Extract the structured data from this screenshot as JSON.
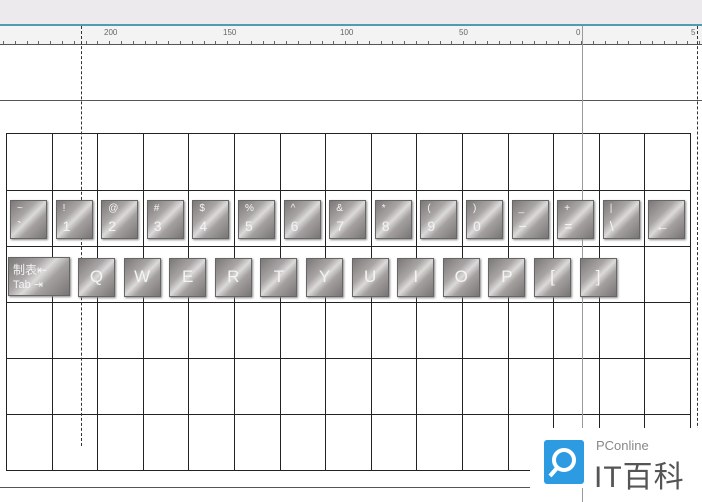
{
  "ruler": {
    "labels": [
      "200",
      "150",
      "100",
      "50",
      "0",
      "5"
    ]
  },
  "keys_row1": [
    {
      "top": "~",
      "bottom": "`"
    },
    {
      "top": "!",
      "bottom": "1"
    },
    {
      "top": "@",
      "bottom": "2"
    },
    {
      "top": "#",
      "bottom": "3"
    },
    {
      "top": "$",
      "bottom": "4"
    },
    {
      "top": "%",
      "bottom": "5"
    },
    {
      "top": "^",
      "bottom": "6"
    },
    {
      "top": "&",
      "bottom": "7"
    },
    {
      "top": "*",
      "bottom": "8"
    },
    {
      "top": "(",
      "bottom": "9"
    },
    {
      "top": ")",
      "bottom": "0"
    },
    {
      "top": "_",
      "bottom": "−"
    },
    {
      "top": "+",
      "bottom": "="
    },
    {
      "top": "|",
      "bottom": "\\"
    },
    {
      "top": "",
      "bottom": "←"
    }
  ],
  "tab_key": {
    "top": "制表⇤",
    "bottom": "Tab ⇥"
  },
  "keys_row2": [
    "Q",
    "W",
    "E",
    "R",
    "T",
    "Y",
    "U",
    "I",
    "O",
    "P",
    "[",
    "]"
  ],
  "watermark": {
    "brand": "PConline",
    "name": "IT百科"
  }
}
